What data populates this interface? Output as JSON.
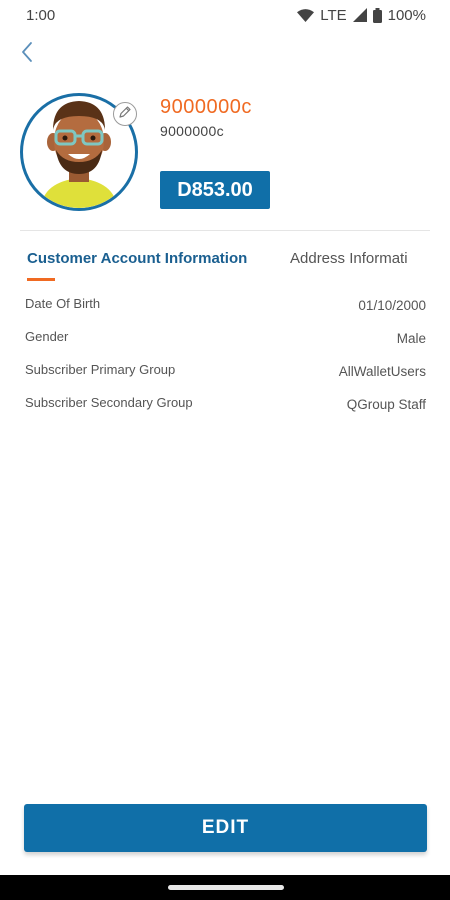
{
  "status_bar": {
    "time": "1:00",
    "network": "LTE",
    "battery": "100%"
  },
  "profile": {
    "name": "9000000c",
    "subtitle": "9000000c",
    "balance": "D853.00"
  },
  "tabs": [
    {
      "label": "Customer Account Information",
      "active": true
    },
    {
      "label": "Address Informati",
      "active": false
    }
  ],
  "info": [
    {
      "label": "Date Of Birth",
      "value": "01/10/2000"
    },
    {
      "label": "Gender",
      "value": "Male"
    },
    {
      "label": "Subscriber Primary Group",
      "value": "AllWalletUsers"
    },
    {
      "label": "Subscriber Secondary Group",
      "value": "QGroup Staff"
    }
  ],
  "actions": {
    "edit_label": "EDIT"
  },
  "colors": {
    "primary": "#106fa8",
    "accent": "#f06a22"
  },
  "icons": {
    "back": "chevron-left-icon",
    "edit_avatar": "pencil-icon",
    "wifi": "wifi-icon",
    "signal": "signal-icon",
    "battery": "battery-icon"
  }
}
